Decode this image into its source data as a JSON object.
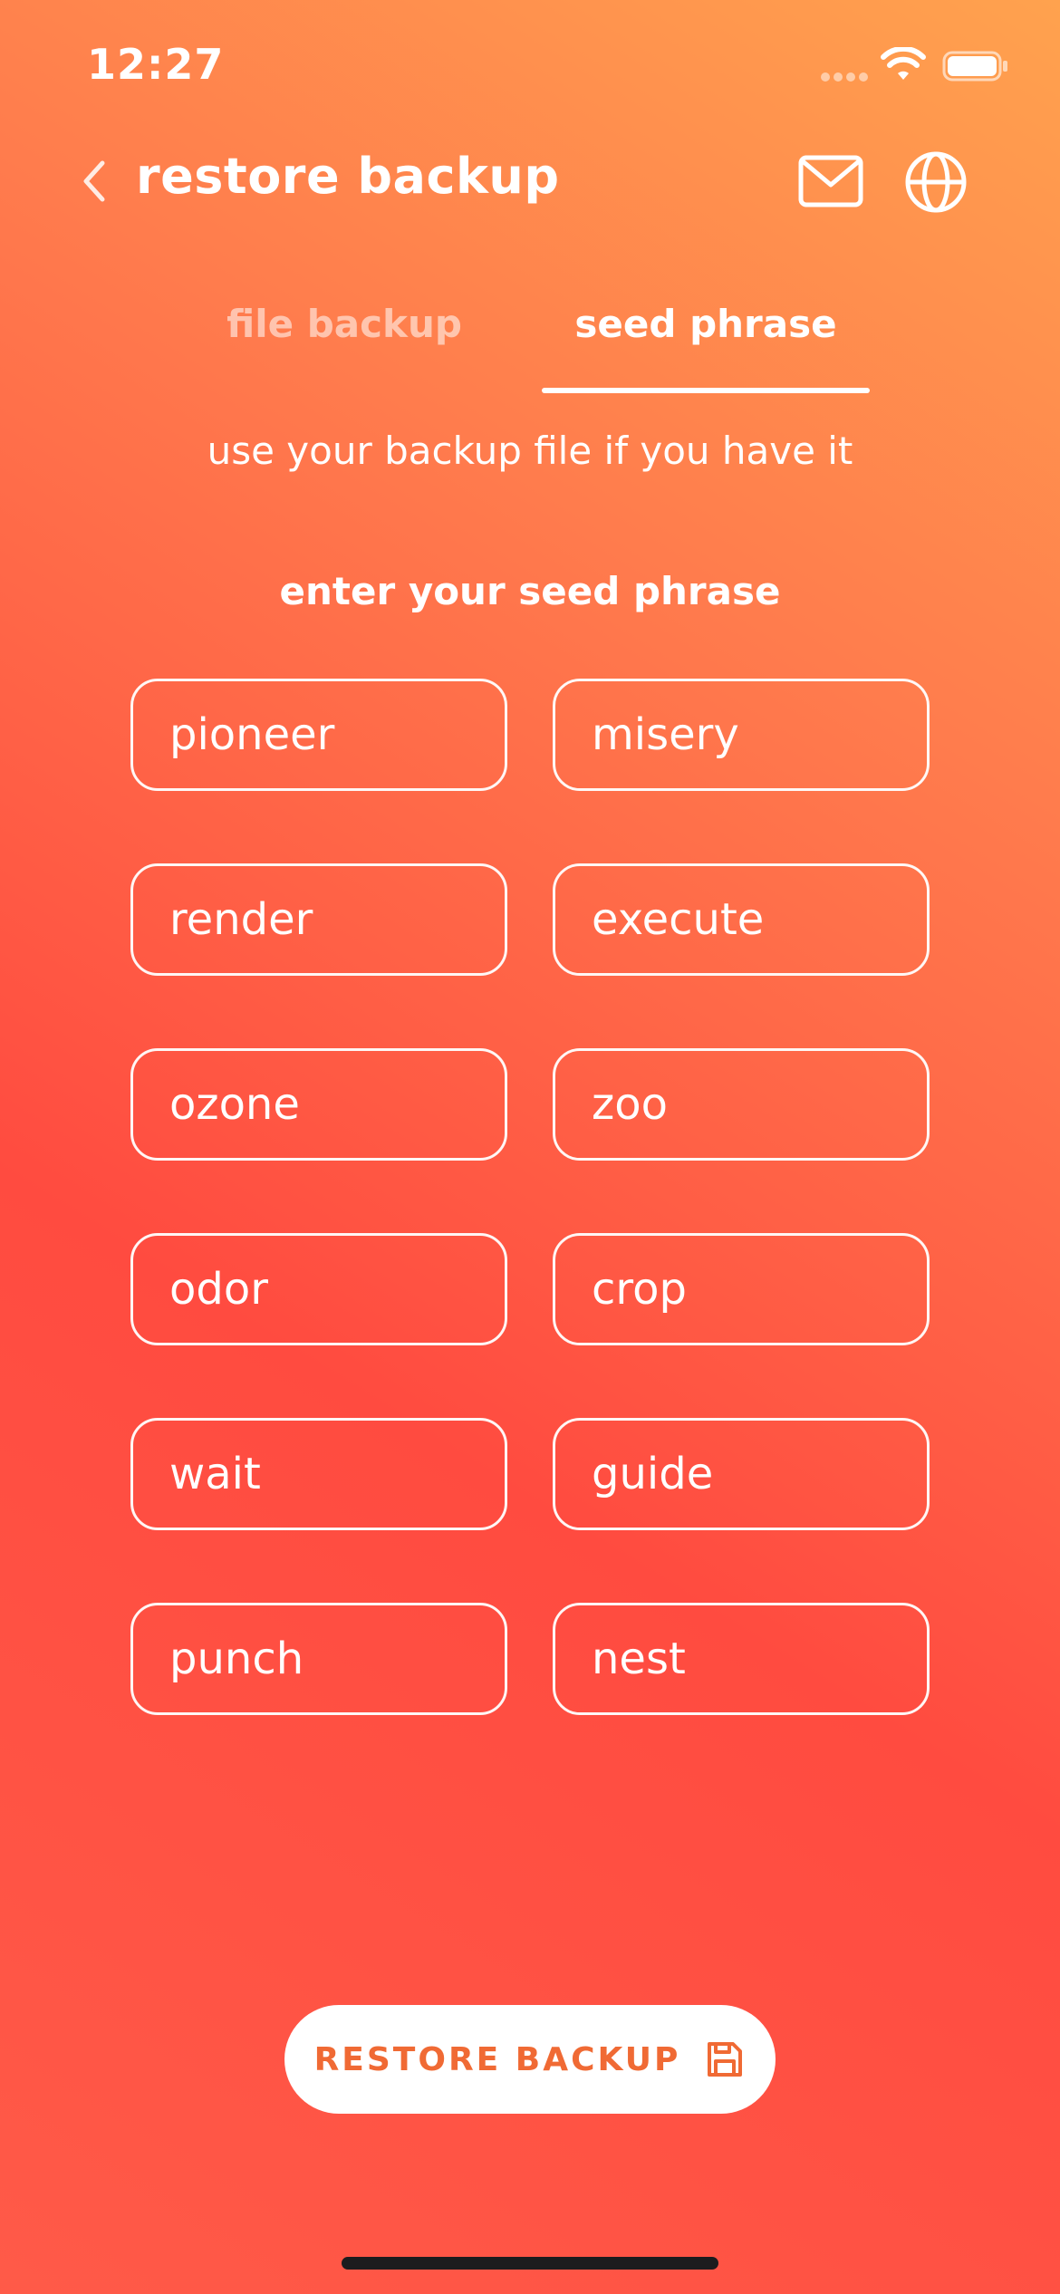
{
  "status_bar": {
    "time": "12:27",
    "icons": [
      "cell-signal-icon",
      "wifi-icon",
      "battery-icon"
    ]
  },
  "header": {
    "title": "restore backup",
    "back_icon": "chevron-left-icon",
    "actions": [
      "mail-icon",
      "globe-icon"
    ]
  },
  "tabs": [
    {
      "label": "file backup",
      "selected": false
    },
    {
      "label": "seed phrase",
      "selected": true
    }
  ],
  "subtitle": "use your backup file if you have it",
  "seed_section": {
    "title": "enter your seed phrase",
    "words": [
      "pioneer",
      "misery",
      "render",
      "execute",
      "ozone",
      "zoo",
      "odor",
      "crop",
      "wait",
      "guide",
      "punch",
      "nest"
    ]
  },
  "restore_button": {
    "label": "RESTORE BACKUP",
    "icon": "save-icon"
  },
  "colors": {
    "gradient_top": "#ffa24e",
    "gradient_bottom": "#ff4b40",
    "accent_text": "#f06a34",
    "tab_inactive": "rgba(255,255,255,0.55)"
  }
}
